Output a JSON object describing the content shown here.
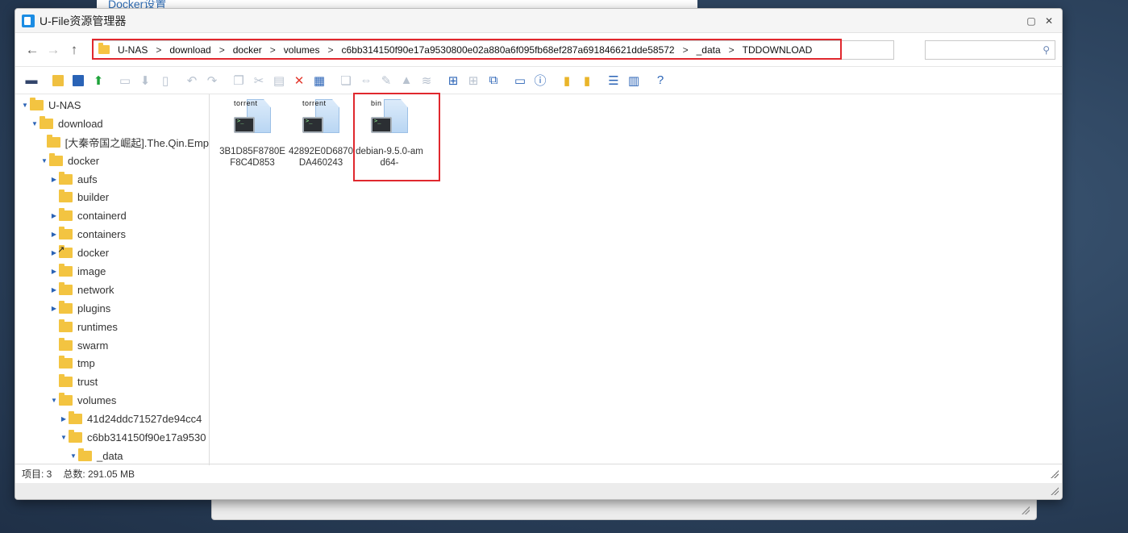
{
  "background_window": {
    "title": "Docker设置"
  },
  "window": {
    "title": "U-File资源管理器"
  },
  "address_bar": {
    "crumbs": [
      "U-NAS",
      "download",
      "docker",
      "volumes",
      "c6bb314150f90e17a9530800e02a880a6f095fb68ef287a691846621dde58572",
      "_data",
      "TDDOWNLOAD"
    ],
    "separator": ">"
  },
  "search": {
    "placeholder": ""
  },
  "tree": [
    {
      "label": "U-NAS",
      "level": 0,
      "arrow": "▼"
    },
    {
      "label": "download",
      "level": 1,
      "arrow": "▼"
    },
    {
      "label": "[大秦帝国之崛起].The.Qin.Emp",
      "level": 2,
      "arrow": ""
    },
    {
      "label": "docker",
      "level": 2,
      "arrow": "▼"
    },
    {
      "label": "aufs",
      "level": 3,
      "arrow": "▶"
    },
    {
      "label": "builder",
      "level": 3,
      "arrow": ""
    },
    {
      "label": "containerd",
      "level": 3,
      "arrow": "▶"
    },
    {
      "label": "containers",
      "level": 3,
      "arrow": "▶"
    },
    {
      "label": "docker",
      "level": 3,
      "arrow": "▶",
      "shortcut": true
    },
    {
      "label": "image",
      "level": 3,
      "arrow": "▶"
    },
    {
      "label": "network",
      "level": 3,
      "arrow": "▶"
    },
    {
      "label": "plugins",
      "level": 3,
      "arrow": "▶"
    },
    {
      "label": "runtimes",
      "level": 3,
      "arrow": ""
    },
    {
      "label": "swarm",
      "level": 3,
      "arrow": ""
    },
    {
      "label": "tmp",
      "level": 3,
      "arrow": ""
    },
    {
      "label": "trust",
      "level": 3,
      "arrow": ""
    },
    {
      "label": "volumes",
      "level": 3,
      "arrow": "▼"
    },
    {
      "label": "41d24ddc71527de94cc4",
      "level": 4,
      "arrow": "▶"
    },
    {
      "label": "c6bb314150f90e17a9530",
      "level": 4,
      "arrow": "▼"
    },
    {
      "label": "_data",
      "level": 5,
      "arrow": "▼"
    }
  ],
  "files": [
    {
      "ext": "torrent",
      "name": "3B1D85F8780EF8C4D853"
    },
    {
      "ext": "torrent",
      "name": "42892E0D6870DA460243"
    },
    {
      "ext": "bin",
      "name": "debian-9.5.0-amd64-"
    }
  ],
  "status": {
    "items_label": "项目: 3",
    "total_label": "总数: 291.05 MB"
  },
  "toolbar_icons": [
    "hdd-icon",
    "new-folder-icon",
    "new-file-icon",
    "upload-icon",
    "folder-disabled-icon",
    "download-icon",
    "file-disabled-icon",
    "undo-icon",
    "redo-icon",
    "copy-icon",
    "cut-icon",
    "paste-icon",
    "delete-icon",
    "rename-icon",
    "duplicate-icon",
    "move-icon",
    "edit-icon",
    "compress-icon",
    "extract-icon",
    "view-large-icon",
    "view-medium-icon",
    "view-small-icon",
    "presentation-icon",
    "info-icon",
    "archive-icon",
    "archive2-icon",
    "list-view-icon",
    "details-view-icon",
    "help-icon"
  ],
  "colors": {
    "accent": "#2a63b6",
    "highlight": "#e0282e",
    "folder": "#f3c441"
  }
}
